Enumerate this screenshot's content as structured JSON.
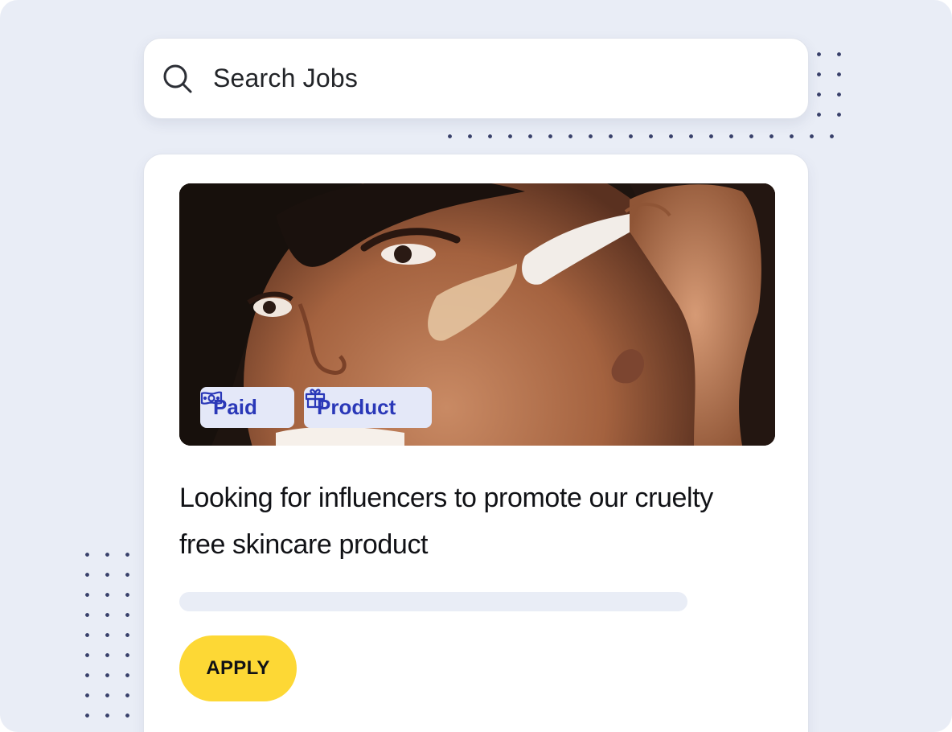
{
  "search": {
    "placeholder": "Search Jobs",
    "icon": "search-icon"
  },
  "job_card": {
    "image": "woman-applying-skincare-photo",
    "tags": [
      {
        "label": "Paid",
        "icon": "cash-icon"
      },
      {
        "label": "Product",
        "icon": "gift-icon"
      }
    ],
    "title": "Looking for influencers to promote our cruelty free skincare product",
    "apply_label": "APPLY"
  },
  "colors": {
    "background": "#e9edf6",
    "card": "#ffffff",
    "tag_bg": "#e4e8f8",
    "tag_text": "#2a38b8",
    "apply_bg": "#fdd835",
    "dots": "#38406a"
  }
}
